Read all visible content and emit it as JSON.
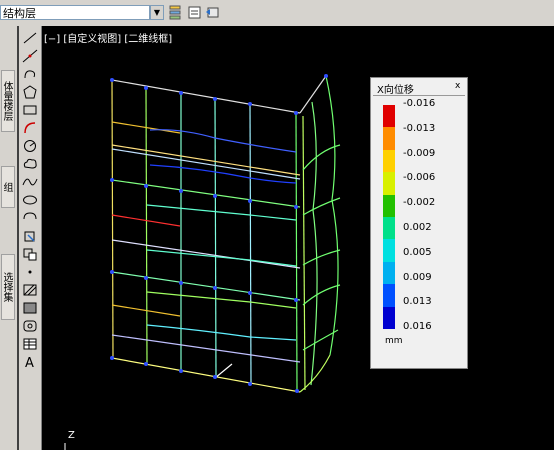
{
  "toolbar": {
    "layer_value": "结构层"
  },
  "left_tabs": [
    "体量楼层",
    "组",
    "选择集"
  ],
  "viewport": {
    "label": "[−] [自定义视图] [二维线框]",
    "axis_label": "Z"
  },
  "legend": {
    "title": "X向位移",
    "close": "x",
    "unit": "mm",
    "values": [
      "-0.016",
      "-0.013",
      "-0.009",
      "-0.006",
      "-0.002",
      "0.002",
      "0.005",
      "0.009",
      "0.013",
      "0.016"
    ],
    "colors": [
      "#e00000",
      "#ff8c00",
      "#ffd000",
      "#d8f000",
      "#22c000",
      "#00e08a",
      "#00e0e0",
      "#00b0f0",
      "#0050ff",
      "#0000d0"
    ]
  }
}
